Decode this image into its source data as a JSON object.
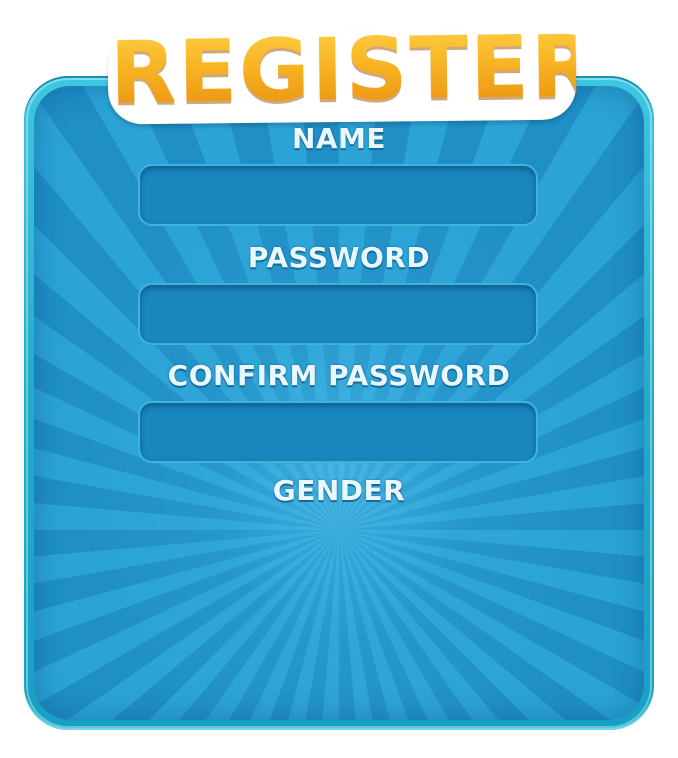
{
  "title": "REGISTER",
  "fields": [
    {
      "label": "NAME",
      "value": ""
    },
    {
      "label": "PASSWORD",
      "value": ""
    },
    {
      "label": "CONFIRM PASSWORD",
      "value": ""
    }
  ],
  "gender": {
    "label": "GENDER"
  },
  "colors": {
    "title": "#f3a316",
    "frame": "#22aacb",
    "panel": "#1e8cc4",
    "label": "#e9f7ff",
    "input_bg": "#1a86be"
  }
}
